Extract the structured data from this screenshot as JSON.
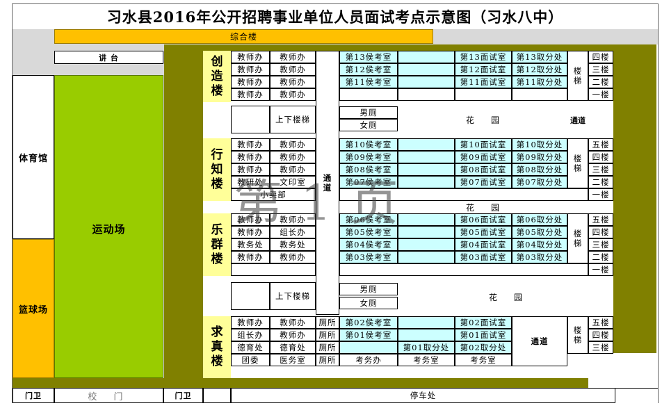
{
  "title": "习水县2016年公开招聘事业单位人员面试考点示意图（习水八中）",
  "site": {
    "building_main": "综合楼",
    "podium": "讲 台",
    "gym": "体育馆",
    "sports_field": "运动场",
    "basketball": "篮球场",
    "gate_guard_left": "门卫",
    "gate": "校 门",
    "gate_guard_right": "门卫",
    "parking": "停车处",
    "corridor": "通道",
    "watermark": "第 1 页"
  },
  "buildings": {
    "chuangzao": {
      "name": [
        "创",
        "造",
        "楼"
      ]
    },
    "xingzhi": {
      "name": [
        "行",
        "知",
        "楼"
      ]
    },
    "lequn": {
      "name": [
        "乐",
        "群",
        "楼"
      ]
    },
    "qiuzhen": {
      "name": [
        "求",
        "真",
        "楼"
      ]
    }
  },
  "block1": {
    "rows": [
      [
        "教师办",
        "教师办",
        "第13侯考室",
        "第13面试室",
        "第13取分处",
        "四楼"
      ],
      [
        "教师办",
        "教师办",
        "第12侯考室",
        "第12面试室",
        "第12取分处",
        "三楼"
      ],
      [
        "教师办",
        "教师办",
        "第11侯考室",
        "第11面试室",
        "第11取分处",
        "二楼"
      ],
      [
        "教师办",
        "教师办",
        "",
        "",
        "",
        "一楼"
      ]
    ],
    "stairs": [
      "楼",
      "梯"
    ]
  },
  "gap1": {
    "stairs": "上下楼梯",
    "male_wc": "男厕",
    "female_wc": "女厕",
    "garden": "花　　园",
    "corridor": "通道"
  },
  "block2": {
    "rows": [
      [
        "教师办",
        "教师办",
        "第10侯考室",
        "第10面试室",
        "第10取分处",
        "五楼"
      ],
      [
        "教师办",
        "教师办",
        "第09侯考室",
        "第09面试室",
        "第09取分处",
        "四楼"
      ],
      [
        "教师办",
        "教师办",
        "第08侯考室",
        "第08面试室",
        "第08取分处",
        "三楼"
      ],
      [
        "教研处",
        "文印室",
        "第07侯考室",
        "第07面试室",
        "第07取分处",
        "二楼"
      ]
    ],
    "shop": "小卖部",
    "floor1": "一楼",
    "stairs": [
      "楼",
      "梯"
    ],
    "passage": [
      "通",
      "道"
    ],
    "garden2": "花　　园"
  },
  "block3": {
    "rows": [
      [
        "教师办",
        "教师办",
        "第06侯考室",
        "第06面试室",
        "第06取分处",
        "五楼"
      ],
      [
        "教师办",
        "组长办",
        "第05侯考室",
        "第05面试室",
        "第05取分处",
        "四楼"
      ],
      [
        "教务处",
        "教务处",
        "第04侯考室",
        "第04面试室",
        "第04取分处",
        "三楼"
      ],
      [
        "教师办",
        "教师办",
        "第03侯考室",
        "第03面试室",
        "第03取分处",
        "二楼"
      ]
    ],
    "floor1": "一楼",
    "stairs": [
      "楼",
      "梯"
    ]
  },
  "gap2": {
    "stairs": "上下楼梯",
    "male_wc": "男厕",
    "female_wc": "女厕",
    "garden": "花　　园"
  },
  "block4": {
    "rows": [
      [
        "教师办",
        "教师办",
        "厕所",
        "第02侯考室",
        "",
        "第02面试室",
        "五楼"
      ],
      [
        "组长办",
        "教师办",
        "厕所",
        "第01侯考室",
        "",
        "第01面试室",
        "四楼"
      ],
      [
        "德育处",
        "德育处",
        "厕所",
        "",
        "第01取分处",
        "第02取分处",
        "三楼"
      ],
      [
        "团委",
        "医务室",
        "厕所",
        "考务办",
        "考务室",
        "考务室",
        ""
      ]
    ],
    "corridor": "通道",
    "stairs": [
      "楼",
      "梯"
    ]
  }
}
